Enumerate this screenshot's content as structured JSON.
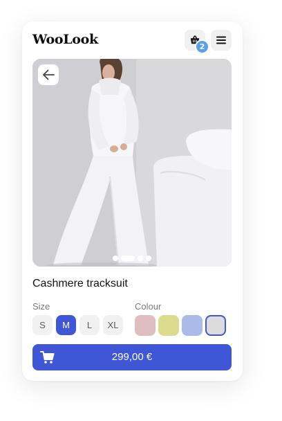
{
  "brand": {
    "logo_text": "WooLook"
  },
  "header": {
    "cart_count": "2"
  },
  "gallery": {
    "slide_count": 4,
    "active_slide": 1
  },
  "product": {
    "title": "Cashmere tracksuit"
  },
  "size": {
    "label": "Size",
    "options": [
      "S",
      "M",
      "L",
      "XL"
    ],
    "selected": "M"
  },
  "colour": {
    "label": "Colour",
    "swatches": [
      "#e0bdbf",
      "#dbdc8e",
      "#aabbe9",
      "#dcdcdc"
    ],
    "selected_index": 3
  },
  "buy": {
    "price": "299,00 €"
  },
  "colors": {
    "accent": "#3f56d6",
    "badge": "#5aa0ee"
  }
}
